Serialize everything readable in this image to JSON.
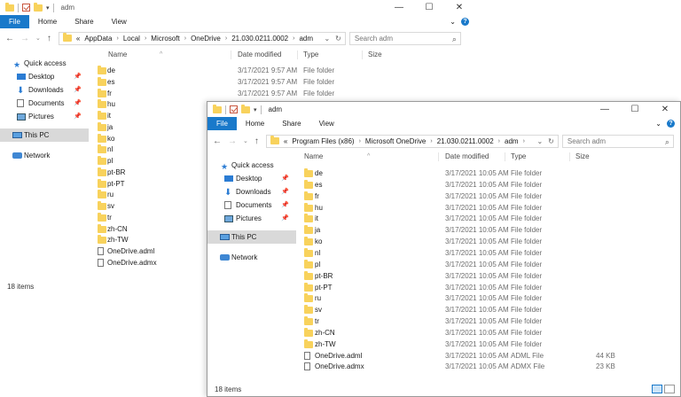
{
  "back_window": {
    "title": "adm",
    "ribbon_tabs": [
      "File",
      "Home",
      "Share",
      "View"
    ],
    "address_crumbs": [
      "«",
      "AppData",
      "Local",
      "Microsoft",
      "OneDrive",
      "21.030.0211.0002",
      "adm"
    ],
    "search_placeholder": "Search adm",
    "columns": {
      "name": "Name",
      "date": "Date modified",
      "type": "Type",
      "size": "Size"
    },
    "nav": {
      "quick_access": "Quick access",
      "desktop": "Desktop",
      "downloads": "Downloads",
      "documents": "Documents",
      "pictures": "Pictures",
      "this_pc": "This PC",
      "network": "Network"
    },
    "visible_rows": [
      {
        "name": "de",
        "date": "3/17/2021 9:57 AM",
        "type": "File folder"
      },
      {
        "name": "es",
        "date": "3/17/2021 9:57 AM",
        "type": "File folder"
      },
      {
        "name": "fr",
        "date": "3/17/2021 9:57 AM",
        "type": "File folder"
      }
    ],
    "list_names": [
      "de",
      "es",
      "fr",
      "hu",
      "it",
      "ja",
      "ko",
      "nl",
      "pl",
      "pt-BR",
      "pt-PT",
      "ru",
      "sv",
      "tr",
      "zh-CN",
      "zh-TW",
      "OneDrive.adml",
      "OneDrive.admx"
    ],
    "status": "18 items"
  },
  "front_window": {
    "title": "adm",
    "ribbon_tabs": [
      "File",
      "Home",
      "Share",
      "View"
    ],
    "address_crumbs": [
      "«",
      "Program Files (x86)",
      "Microsoft OneDrive",
      "21.030.0211.0002",
      "adm"
    ],
    "search_placeholder": "Search adm",
    "columns": {
      "name": "Name",
      "date": "Date modified",
      "type": "Type",
      "size": "Size"
    },
    "nav": {
      "quick_access": "Quick access",
      "desktop": "Desktop",
      "downloads": "Downloads",
      "documents": "Documents",
      "pictures": "Pictures",
      "this_pc": "This PC",
      "network": "Network"
    },
    "rows": [
      {
        "name": "de",
        "date": "3/17/2021 10:05 AM",
        "type": "File folder",
        "size": "",
        "kind": "folder"
      },
      {
        "name": "es",
        "date": "3/17/2021 10:05 AM",
        "type": "File folder",
        "size": "",
        "kind": "folder"
      },
      {
        "name": "fr",
        "date": "3/17/2021 10:05 AM",
        "type": "File folder",
        "size": "",
        "kind": "folder"
      },
      {
        "name": "hu",
        "date": "3/17/2021 10:05 AM",
        "type": "File folder",
        "size": "",
        "kind": "folder"
      },
      {
        "name": "it",
        "date": "3/17/2021 10:05 AM",
        "type": "File folder",
        "size": "",
        "kind": "folder"
      },
      {
        "name": "ja",
        "date": "3/17/2021 10:05 AM",
        "type": "File folder",
        "size": "",
        "kind": "folder"
      },
      {
        "name": "ko",
        "date": "3/17/2021 10:05 AM",
        "type": "File folder",
        "size": "",
        "kind": "folder"
      },
      {
        "name": "nl",
        "date": "3/17/2021 10:05 AM",
        "type": "File folder",
        "size": "",
        "kind": "folder"
      },
      {
        "name": "pl",
        "date": "3/17/2021 10:05 AM",
        "type": "File folder",
        "size": "",
        "kind": "folder"
      },
      {
        "name": "pt-BR",
        "date": "3/17/2021 10:05 AM",
        "type": "File folder",
        "size": "",
        "kind": "folder"
      },
      {
        "name": "pt-PT",
        "date": "3/17/2021 10:05 AM",
        "type": "File folder",
        "size": "",
        "kind": "folder"
      },
      {
        "name": "ru",
        "date": "3/17/2021 10:05 AM",
        "type": "File folder",
        "size": "",
        "kind": "folder"
      },
      {
        "name": "sv",
        "date": "3/17/2021 10:05 AM",
        "type": "File folder",
        "size": "",
        "kind": "folder"
      },
      {
        "name": "tr",
        "date": "3/17/2021 10:05 AM",
        "type": "File folder",
        "size": "",
        "kind": "folder"
      },
      {
        "name": "zh-CN",
        "date": "3/17/2021 10:05 AM",
        "type": "File folder",
        "size": "",
        "kind": "folder"
      },
      {
        "name": "zh-TW",
        "date": "3/17/2021 10:05 AM",
        "type": "File folder",
        "size": "",
        "kind": "folder"
      },
      {
        "name": "OneDrive.adml",
        "date": "3/17/2021 10:05 AM",
        "type": "ADML File",
        "size": "44 KB",
        "kind": "file"
      },
      {
        "name": "OneDrive.admx",
        "date": "3/17/2021 10:05 AM",
        "type": "ADMX File",
        "size": "23 KB",
        "kind": "file"
      }
    ],
    "status": "18 items"
  },
  "colors": {
    "accent": "#1979ca",
    "folder": "#f8d25c",
    "selected_nav": "#d9d9d9"
  }
}
